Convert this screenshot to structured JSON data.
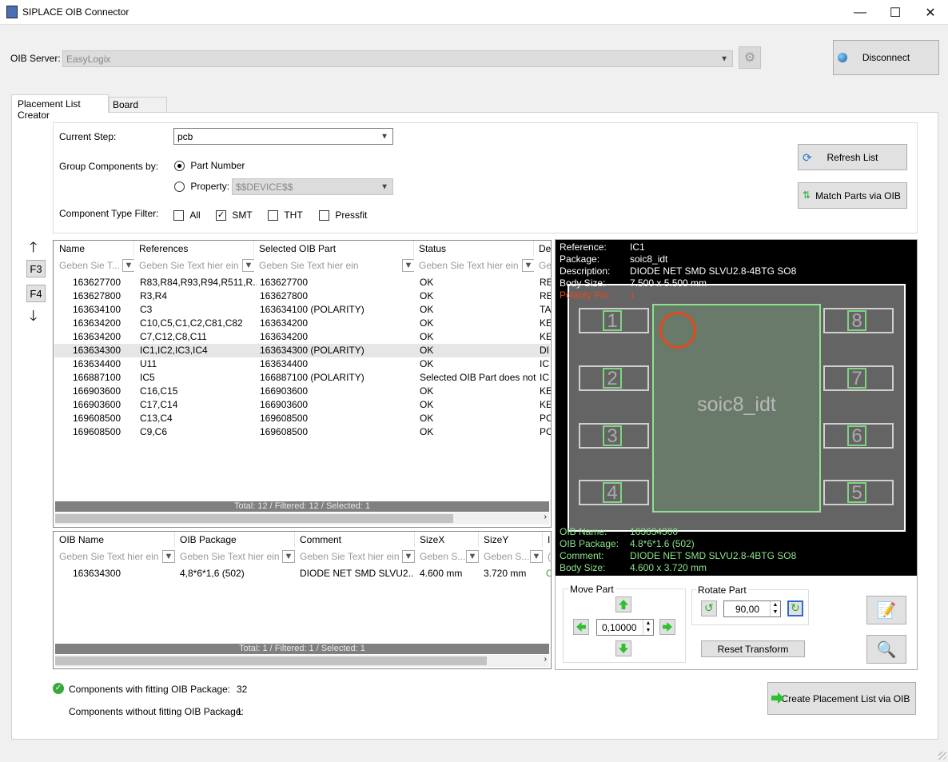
{
  "window": {
    "title": "SIPLACE OIB Connector",
    "min": "—",
    "max": "☐",
    "close": "✕"
  },
  "server": {
    "label": "OIB Server:",
    "value": "EasyLogix",
    "disconnect": "Disconnect"
  },
  "tabs": [
    {
      "label": "Placement List Creator"
    },
    {
      "label": "Board Creator"
    }
  ],
  "form": {
    "current_step_label": "Current Step:",
    "current_step_value": "pcb",
    "group_label": "Group Components by:",
    "part_number_label": "Part Number",
    "property_label": "Property:",
    "property_value": "$$DEVICE$$",
    "type_filter_label": "Component Type Filter:",
    "filters": {
      "all": "All",
      "smt": "SMT",
      "tht": "THT",
      "pressfit": "Pressfit"
    }
  },
  "actions": {
    "refresh": "Refresh List",
    "match": "Match Parts via OIB",
    "create": "Create Placement List via OIB",
    "reset_transform": "Reset Transform"
  },
  "nav": {
    "f3": "F3",
    "f4": "F4"
  },
  "parts_table": {
    "columns": [
      "Name",
      "References",
      "Selected OIB Part",
      "Status",
      "De"
    ],
    "filter_placeholders": [
      "Geben Sie T...",
      "Geben Sie Text hier ein",
      "Geben Sie Text hier ein",
      "Geben Sie Text hier ein",
      "Ge"
    ],
    "rows": [
      {
        "icon": "ok",
        "name": "163627700",
        "refs": "R83,R84,R93,R94,R511,R...",
        "part": "163627700",
        "status": "OK",
        "de": "RE"
      },
      {
        "icon": "ok",
        "name": "163627800",
        "refs": "R3,R4",
        "part": "163627800",
        "status": "OK",
        "de": "RE"
      },
      {
        "icon": "ok",
        "name": "163634100",
        "refs": "C3",
        "part": "163634100 (POLARITY)",
        "status": "OK",
        "de": "TA"
      },
      {
        "icon": "ok",
        "name": "163634200",
        "refs": "C10,C5,C1,C2,C81,C82",
        "part": "163634200",
        "status": "OK",
        "de": "KE"
      },
      {
        "icon": "ok",
        "name": "163634200",
        "refs": "C7,C12,C8,C11",
        "part": "163634200",
        "status": "OK",
        "de": "KE"
      },
      {
        "icon": "ok",
        "name": "163634300",
        "refs": "IC1,IC2,IC3,IC4",
        "part": "163634300 (POLARITY)",
        "status": "OK",
        "de": "DI",
        "selected": true
      },
      {
        "icon": "ok",
        "name": "163634400",
        "refs": "U11",
        "part": "163634400",
        "status": "OK",
        "de": "IC"
      },
      {
        "icon": "warn",
        "name": "166887100",
        "refs": "IC5",
        "part": "166887100 (POLARITY)",
        "status": "Selected OIB Part does not...",
        "de": "IC"
      },
      {
        "icon": "ok",
        "name": "166903600",
        "refs": "C16,C15",
        "part": "166903600",
        "status": "OK",
        "de": "KE"
      },
      {
        "icon": "ok",
        "name": "166903600",
        "refs": "C17,C14",
        "part": "166903600",
        "status": "OK",
        "de": "KE"
      },
      {
        "icon": "ok",
        "name": "169608500",
        "refs": "C13,C4",
        "part": "169608500",
        "status": "OK",
        "de": "PC"
      },
      {
        "icon": "ok",
        "name": "169608500",
        "refs": "C9,C6",
        "part": "169608500",
        "status": "OK",
        "de": "PC"
      }
    ],
    "footer": "Total: 12 / Filtered: 12 / Selected: 1"
  },
  "oib_table": {
    "columns": [
      "OIB Name",
      "OIB Package",
      "Comment",
      "SizeX",
      "SizeY",
      "I"
    ],
    "filter_placeholders": [
      "Geben Sie Text hier ein",
      "Geben Sie Text hier ein",
      "Geben Sie Text hier ein",
      "Geben S...",
      "Geben S...",
      "("
    ],
    "rows": [
      {
        "checked": true,
        "name": "163634300",
        "package": "4,8*6*1,6 (502)",
        "comment": "DIODE NET SMD SLVU2....",
        "sizex": "4.600 mm",
        "sizey": "3.720 mm",
        "extra": "C"
      }
    ],
    "footer": "Total: 1 / Filtered: 1 / Selected: 1"
  },
  "viewer": {
    "info": {
      "reference_label": "Reference:",
      "reference": "IC1",
      "package_label": "Package:",
      "package": "soic8_idt",
      "description_label": "Description:",
      "description": "DIODE NET SMD SLVU2.8-4BTG SO8",
      "body_size_label": "Body Size:",
      "body_size": "7.500 x 5.500 mm",
      "polarity_label": "Polarity Pin:",
      "polarity": "1"
    },
    "package_name": "soic8_idt",
    "pins": [
      "1",
      "2",
      "3",
      "4",
      "8",
      "7",
      "6",
      "5"
    ],
    "oib": {
      "name_label": "OIB Name:",
      "name": "163634300",
      "package_label": "OIB Package:",
      "package": "4.8*6*1.6 (502)",
      "comment_label": "Comment:",
      "comment": "DIODE NET SMD SLVU2.8-4BTG SO8",
      "body_label": "Body Size:",
      "body": "4.600 x 3.720 mm"
    },
    "colors": {
      "polarity": "#e24a1c",
      "oib_text": "#8ee28e",
      "pad": "#cfcfcf",
      "body": "#5e6e5e"
    }
  },
  "transform": {
    "move_label": "Move Part",
    "move_value": "0,10000",
    "rotate_label": "Rotate Part",
    "rotate_value": "90,00"
  },
  "summary": {
    "fitting_label": "Components with fitting OIB Package:",
    "fitting_count": "32",
    "nonfitting_label": "Components without fitting OIB Package:",
    "nonfitting_count": "1"
  }
}
